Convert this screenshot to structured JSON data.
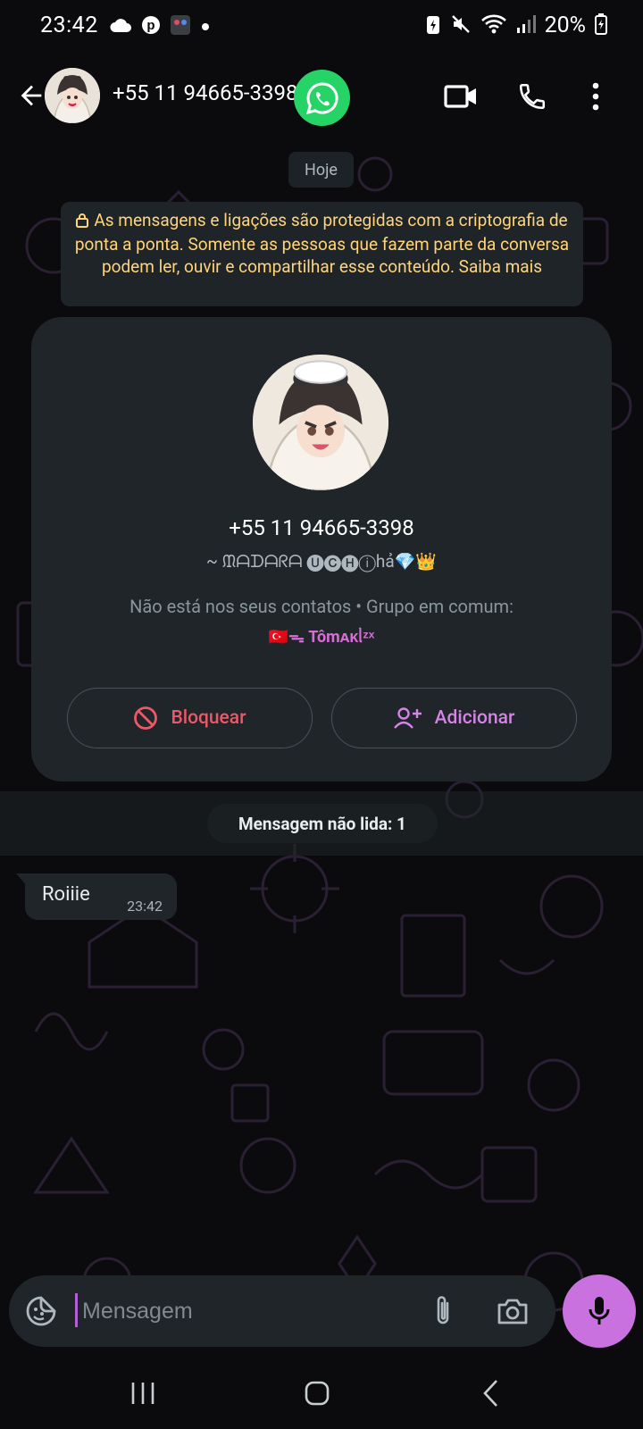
{
  "status_bar": {
    "time": "23:42",
    "battery": "20%"
  },
  "header": {
    "title": "+55 11 94665-3398",
    "back_icon": "arrow-left-icon",
    "actions": [
      "video-call-icon",
      "phone-icon",
      "more-vertical-icon"
    ]
  },
  "chat": {
    "date_chip": "Hoje",
    "encryption_notice": "As mensagens e ligações são protegidas com a criptografia de ponta a ponta. Somente as pessoas que fazem parte da conversa podem ler, ouvir e compartilhar esse conteúdo. Saiba mais",
    "contact_card": {
      "phone": "+55 11 94665-3398",
      "profile_name": "~ ᙢᗩᗪᗩᖇᗩ 🅤🅒🅗ⓘhả💎👑",
      "info": "Não está nos seus contatos • Grupo em comum:",
      "group_name": "🇹🇷ᯓ Tômᴀᴋᥣᶻˣ",
      "block_label": "Bloquear",
      "add_label": "Adicionar"
    },
    "unread_label": "Mensagem não lida: 1",
    "messages": [
      {
        "text": "Roiiie",
        "time": "23:42"
      }
    ]
  },
  "composer": {
    "placeholder": "Mensagem"
  },
  "colors": {
    "background": "#0b0b0d",
    "bubble": "#1f2529",
    "accent": "#c971de",
    "whatsapp_green": "#25d366",
    "block_red": "#ec5868",
    "encryption_yellow": "#ffd47a"
  }
}
